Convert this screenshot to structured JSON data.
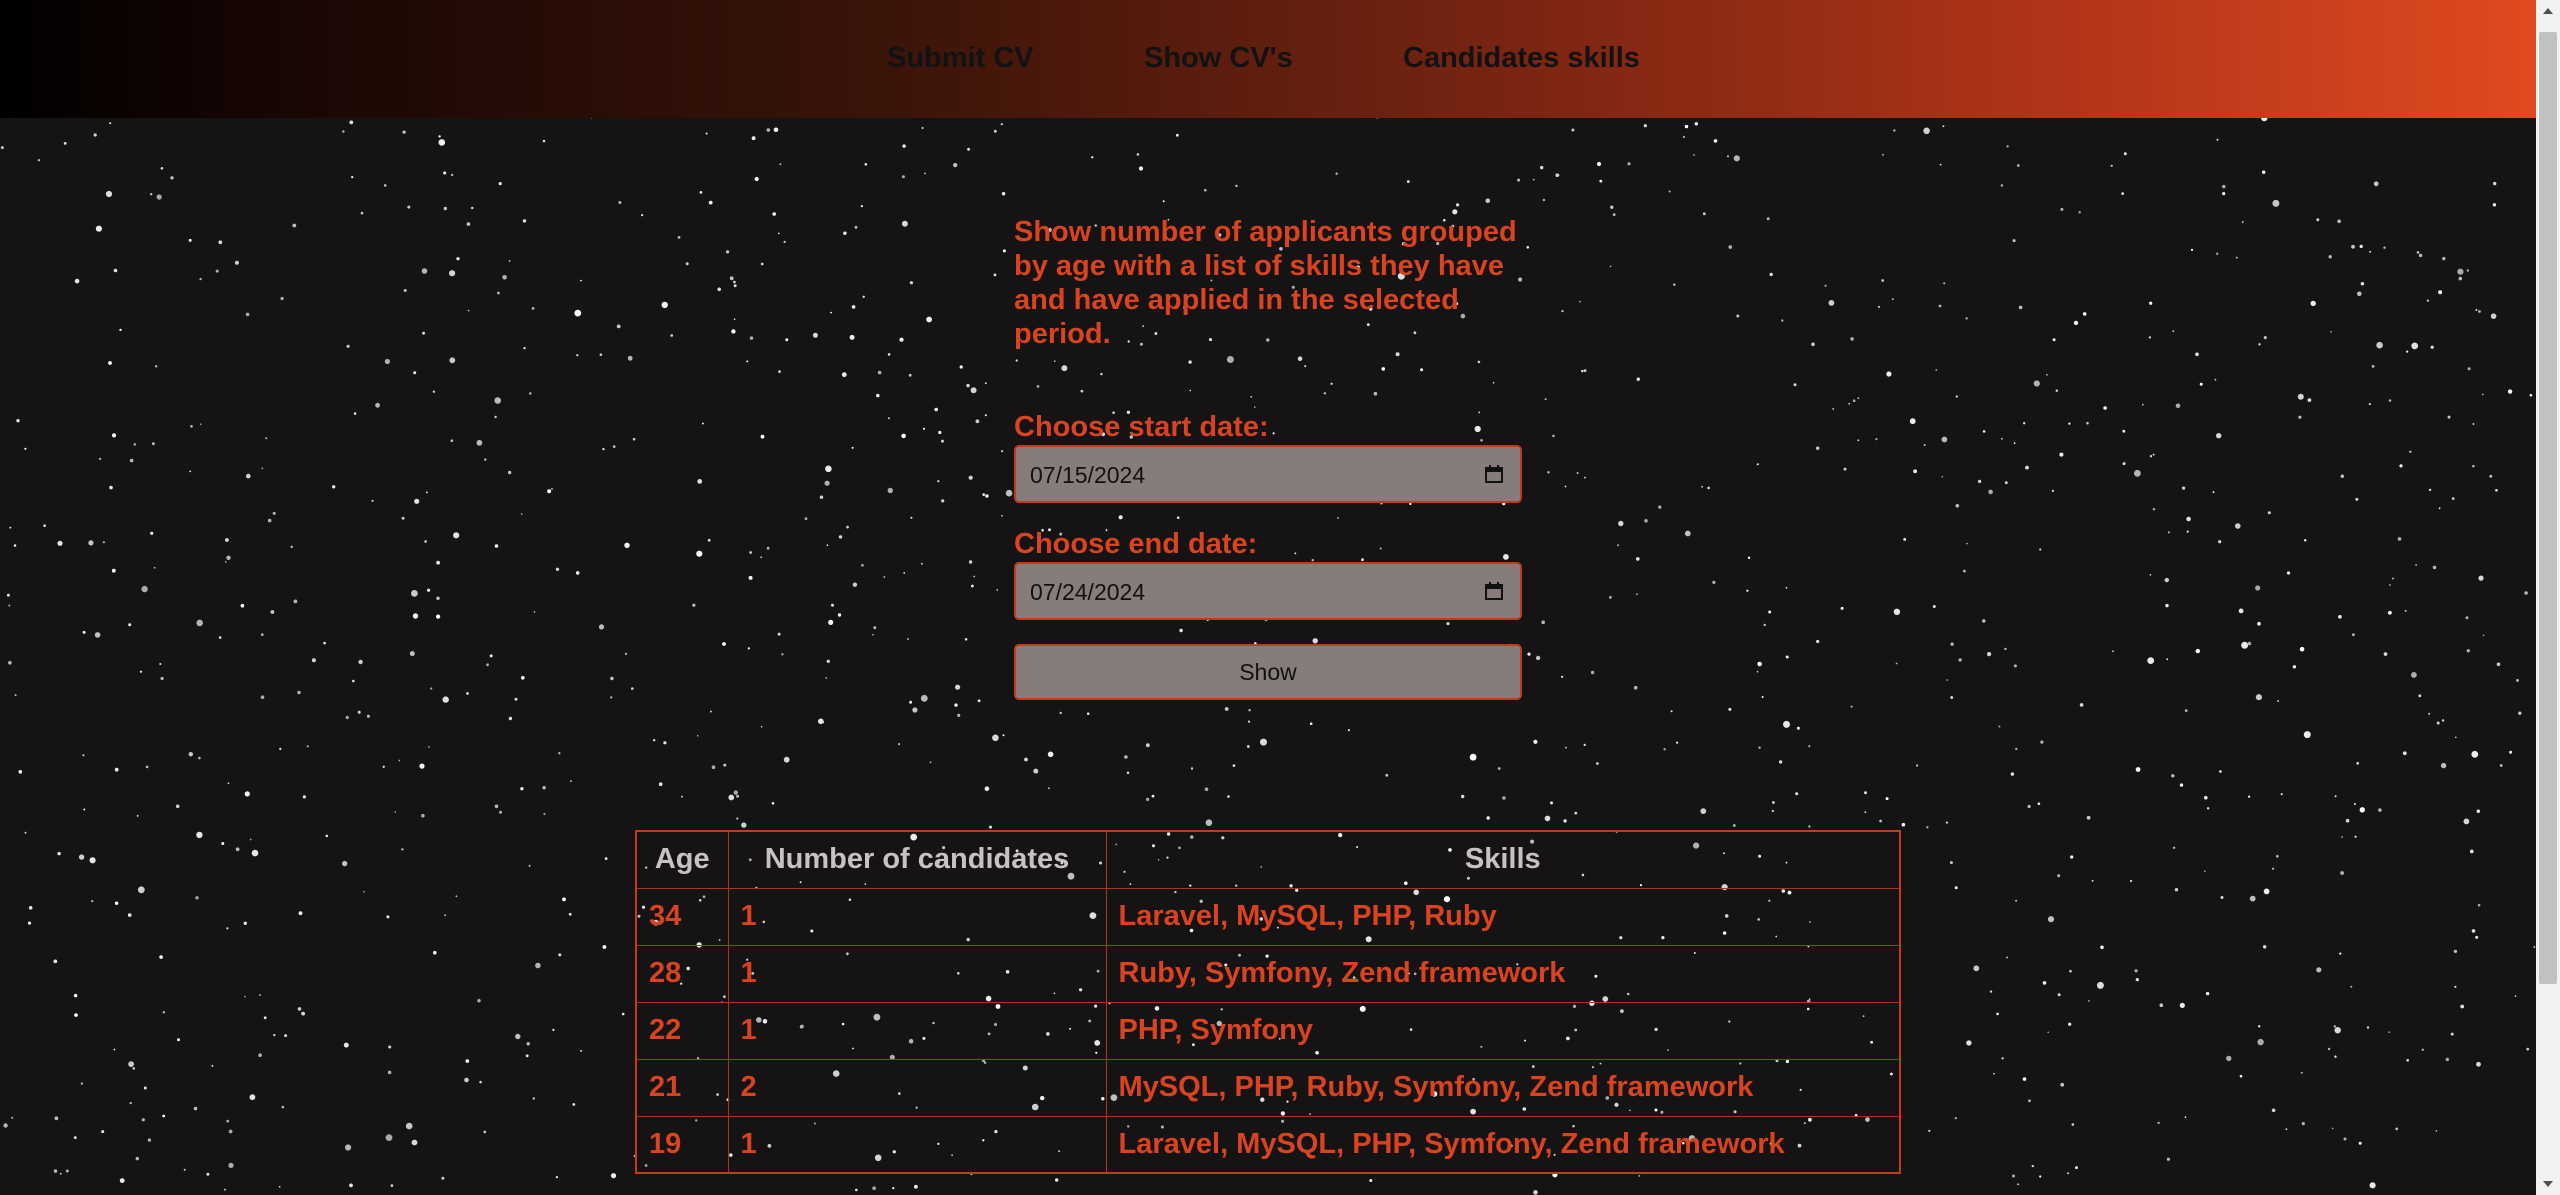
{
  "nav": {
    "links": [
      "Submit CV",
      "Show CV's",
      "Candidates skills"
    ]
  },
  "colors": {
    "accent": "#d9431f",
    "background": "#151314",
    "input_bg": "#877c7c",
    "header_text": "#c6c2c2"
  },
  "form": {
    "description": "Show number of applicants grouped by age with a list of skills they have and have applied in the selected period.",
    "start_label": "Choose start date:",
    "start_value": "07/15/2024",
    "end_label": "Choose end date:",
    "end_value": "07/24/2024",
    "submit_label": "Show",
    "date_picker_icon": "calendar-icon"
  },
  "table": {
    "headers": [
      "Age",
      "Number of candidates",
      "Skills"
    ],
    "rows": [
      [
        "34",
        "1",
        "Laravel, MySQL, PHP, Ruby"
      ],
      [
        "28",
        "1",
        "Ruby, Symfony, Zend framework"
      ],
      [
        "22",
        "1",
        "PHP, Symfony"
      ],
      [
        "21",
        "2",
        "MySQL, PHP, Ruby, Symfony, Zend framework"
      ],
      [
        "19",
        "1",
        "Laravel, MySQL, PHP, Symfony, Zend framework"
      ]
    ]
  }
}
